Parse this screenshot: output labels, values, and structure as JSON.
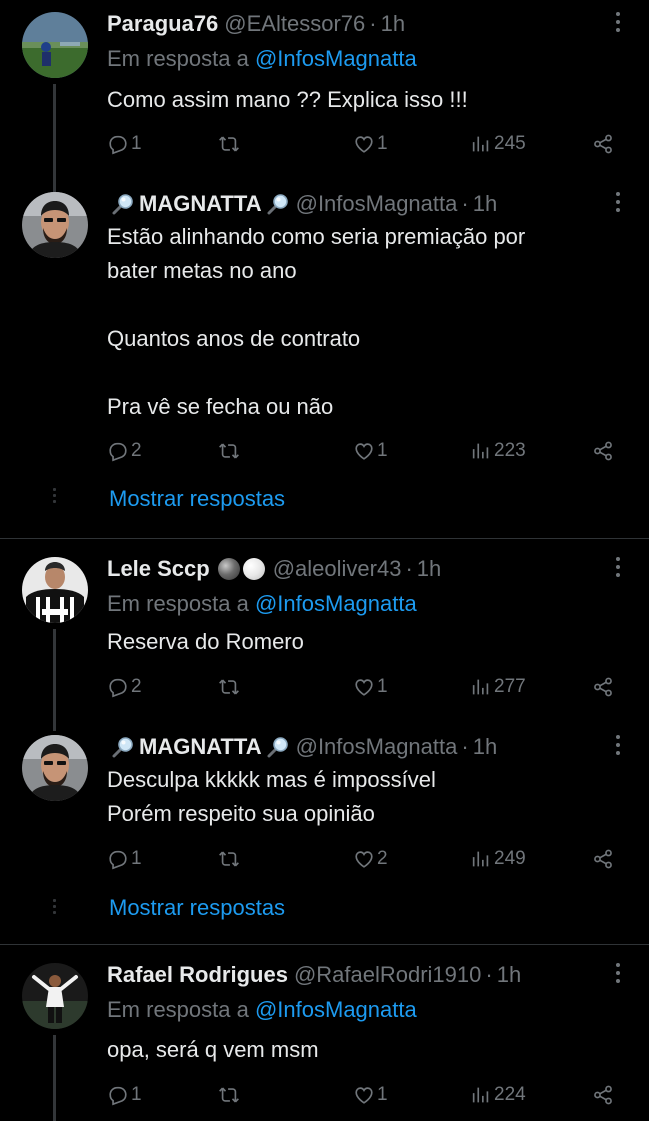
{
  "tweets": [
    {
      "name": "Paragua76",
      "handle": "@EAltessor76",
      "time": "1h",
      "reply_prefix": "Em resposta a",
      "reply_mention": "@InfosMagnatta",
      "text": "Como assim mano ?? Explica isso !!!",
      "replies": "1",
      "likes": "1",
      "views": "245"
    },
    {
      "name": "MAGNATTA",
      "handle": "@InfosMagnatta",
      "time": "1h",
      "text": "Estão alinhando como seria premiação por\nbater metas no ano\n\nQuantos anos de contrato\n\nPra vê se fecha ou não",
      "replies": "2",
      "likes": "1",
      "views": "223"
    },
    {
      "name": "Lele Sccp",
      "handle": "@aleoliver43",
      "time": "1h",
      "reply_prefix": "Em resposta a",
      "reply_mention": "@InfosMagnatta",
      "text": "Reserva do Romero",
      "replies": "2",
      "likes": "1",
      "views": "277"
    },
    {
      "name": "MAGNATTA",
      "handle": "@InfosMagnatta",
      "time": "1h",
      "text": "Desculpa kkkkk mas é impossível\nPorém respeito sua opinião",
      "replies": "1",
      "likes": "2",
      "views": "249"
    },
    {
      "name": "Rafael Rodrigues",
      "handle": "@RafaelRodri1910",
      "time": "1h",
      "reply_prefix": "Em resposta a",
      "reply_mention": "@InfosMagnatta",
      "text": "opa, será q vem msm",
      "replies": "1",
      "likes": "1",
      "views": "224"
    }
  ],
  "show_replies_label": "Mostrar respostas",
  "dot_separator": "·",
  "colors": {
    "background": "#000000",
    "text": "#e7e9ea",
    "muted": "#71767b",
    "link": "#1d9bf0",
    "divider": "#2f3336"
  },
  "icons": [
    "reply-icon",
    "retweet-icon",
    "like-icon",
    "views-icon",
    "share-icon",
    "more-icon",
    "magnifier-emoji-icon"
  ]
}
